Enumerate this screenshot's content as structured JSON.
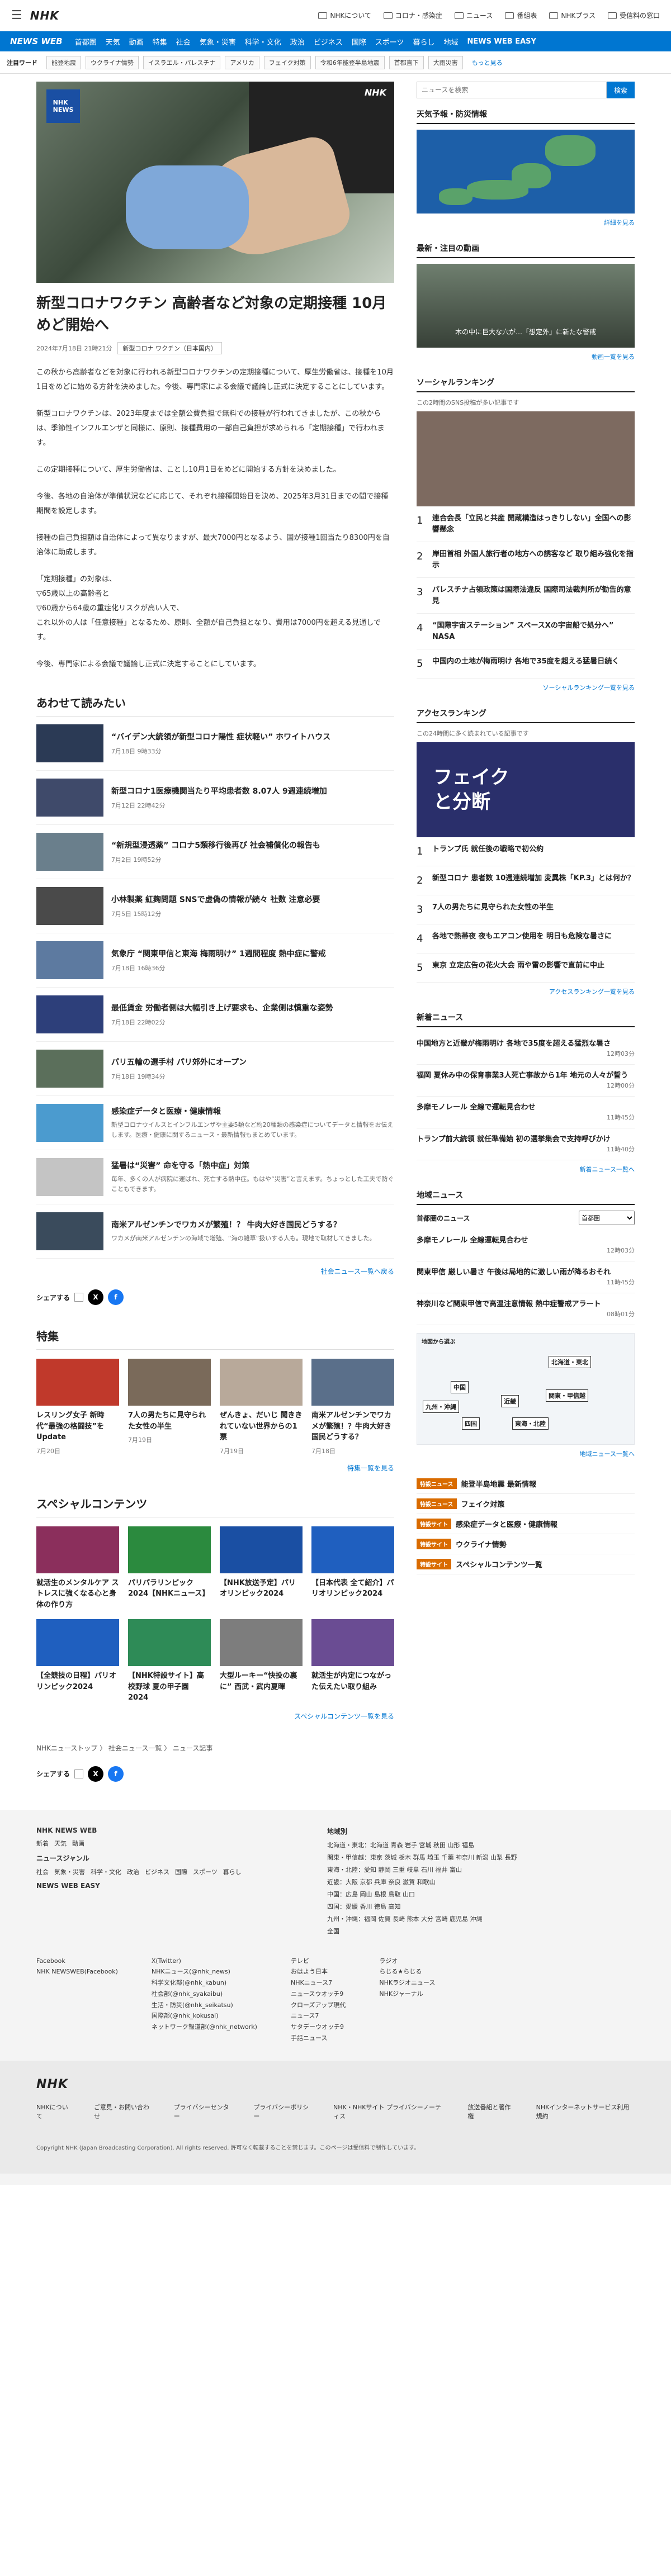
{
  "header": {
    "logo": "NHK",
    "links": [
      "NHKについて",
      "コロナ・感染症",
      "ニュース",
      "番組表",
      "NHKプラス",
      "受信料の窓口"
    ]
  },
  "nav": {
    "brand": "NEWS WEB",
    "items": [
      "首都圏",
      "天気",
      "動画",
      "特集",
      "社会",
      "気象・災害",
      "科学・文化",
      "政治",
      "ビジネス",
      "国際",
      "スポーツ",
      "暮らし",
      "地域",
      "NEWS WEB EASY"
    ]
  },
  "keywords": {
    "label": "注目ワード",
    "items": [
      "能登地震",
      "ウクライナ情勢",
      "イスラエル・パレスチナ",
      "アメリカ",
      "フェイク対策",
      "令和6年能登半島地震",
      "首都直下",
      "大雨災害"
    ],
    "more": "もっと見る"
  },
  "article": {
    "title": "新型コロナワクチン 高齢者など対象の定期接種 10月めど開始へ",
    "date": "2024年7月18日 21時21分",
    "tag": "新型コロナ ワクチン（日本国内）",
    "lead": "この秋から高齢者などを対象に行われる新型コロナワクチンの定期接種について、厚生労働省は、接種を10月1日をめどに始める方針を決めました。今後、専門家による会議で議論し正式に決定することにしています。",
    "paragraphs": [
      "新型コロナワクチンは、2023年度までは全額公費負担で無料での接種が行われてきましたが、この秋からは、季節性インフルエンザと同様に、原則、接種費用の一部自己負担が求められる「定期接種」で行われます。",
      "この定期接種について、厚生労働省は、ことし10月1日をめどに開始する方針を決めました。",
      "今後、各地の自治体が準備状況などに応じて、それぞれ接種開始日を決め、2025年3月31日までの間で接種期間を設定します。",
      "接種の自己負担額は自治体によって異なりますが、最大7000円となるよう、国が接種1回当たり8300円を自治体に助成します。",
      "「定期接種」の対象は、\n▽65歳以上の高齢者と\n▽60歳から64歳の重症化リスクが高い人で、\nこれ以外の人は「任意接種」となるため、原則、全額が自己負担となり、費用は7000円を超える見通しです。",
      "今後、専門家による会議で議論し正式に決定することにしています。"
    ]
  },
  "related": {
    "heading": "あわせて読みたい",
    "items": [
      {
        "title": "“バイデン大統領が新型コロナ陽性 症状軽い” ホワイトハウス",
        "date": "7月18日 9時33分",
        "desc": ""
      },
      {
        "title": "新型コロナ1医療機関当たり平均患者数 8.07人 9週連続増加",
        "date": "7月12日 22時42分",
        "desc": ""
      },
      {
        "title": "“新規型浸透薬” コロナ5類移行後再び 社会補償化の報告も",
        "date": "7月2日 19時52分",
        "desc": ""
      },
      {
        "title": "小林製薬 紅麹問題 SNSで虚偽の情報が続々 社数 注意必要",
        "date": "7月5日 15時12分",
        "desc": ""
      },
      {
        "title": "気象庁 “関東甲信と東海 梅雨明け” 1週間程度 熱中症に警戒",
        "date": "7月18日 16時36分",
        "desc": ""
      },
      {
        "title": "最低賃金 労働者側は大幅引き上げ要求も、企業側は慎重な姿勢",
        "date": "7月18日 22時02分",
        "desc": ""
      },
      {
        "title": "パリ五輪の選手村 パリ郊外にオープン",
        "date": "7月18日 19時34分",
        "desc": ""
      },
      {
        "title": "感染症データと医療・健康情報",
        "date": "",
        "desc": "新型コロナウイルスとインフルエンザや主要5類など約20種類の感染症についてデータと情報をお伝えします。医療・健康に関するニュース・最新情報もまとめています。"
      },
      {
        "title": "猛暑は“災害” 命を守る「熱中症」対策",
        "date": "",
        "desc": "毎年、多くの人が病院に運ばれ、死亡する熱中症。もはや“災害”と言えます。ちょっとした工夫で防ぐこともできます。"
      },
      {
        "title": "南米アルゼンチンでワカメが繁殖！？ 牛肉大好き国民どうする？",
        "date": "",
        "desc": "ワカメが南米アルゼンチンの海域で増殖、“海の雑草”扱いする人も。現地で取材してきました。"
      }
    ],
    "more": "社会ニュース一覧へ戻る"
  },
  "share": {
    "label": "シェアする"
  },
  "features": {
    "heading": "特集",
    "items": [
      {
        "title": "レスリング女子 新時代“最強の格闘技”をUpdate",
        "date": "7月20日"
      },
      {
        "title": "7人の男たちに見守られた女性の半生",
        "date": "7月19日"
      },
      {
        "title": "ぜんきょ、だいじ 聞ききれていない世界からの1票",
        "date": "7月19日"
      },
      {
        "title": "南米アルゼンチンでワカメが繁殖！？牛肉大好き国民どうする？",
        "date": "7月18日"
      }
    ],
    "more": "特集一覧を見る"
  },
  "special": {
    "heading": "スペシャルコンテンツ",
    "items": [
      {
        "title": "就活生のメンタルケア ストレスに強くなる心と身体の作り方"
      },
      {
        "title": "パリパラリンピック2024【NHKニュース】"
      },
      {
        "title": "【NHK放送予定】パリオリンピック2024"
      },
      {
        "title": "【日本代表 全て紹介】パリオリンピック2024"
      },
      {
        "title": "【全競技の日程】パリオリンピック2024"
      },
      {
        "title": "【NHK特設サイト】高校野球 夏の甲子園 2024"
      },
      {
        "title": "大型ルーキー“快投の裏に” 西武・武内夏暉"
      },
      {
        "title": "就活生が内定につながった伝えたい取り組み"
      }
    ],
    "more": "スペシャルコンテンツ一覧を見る"
  },
  "breadcrumb": [
    "NHKニューストップ",
    "社会ニュース一覧",
    "ニュース記事"
  ],
  "sidebar": {
    "search_placeholder": "ニュースを検索",
    "search_button": "検索",
    "weather": {
      "heading": "天気予報・防災情報",
      "more": "詳細を見る"
    },
    "video": {
      "heading": "最新・注目の動画",
      "caption": "木の中に巨大な穴が…「想定外」に新たな警戒",
      "more": "動画一覧を見る"
    },
    "social": {
      "heading": "ソーシャルランキング",
      "sub": "この2時間のSNS投稿が多い記事です",
      "items": [
        "連合会長「立民と共産 開蔵構造はっきりしない」全国への影響懸念",
        "岸田首相 外国人旅行者の地方への誘客など 取り組み強化を指示",
        "パレスチナ占領政策は国際法違反 国際司法裁判所が勧告的意見",
        "“国際宇宙ステーション” スペースXの宇宙船で処分へ” NASA",
        "中国内の土地が梅雨明け 各地で35度を超える猛暑日続く"
      ],
      "more": "ソーシャルランキング一覧を見る"
    },
    "access": {
      "heading": "アクセスランキング",
      "sub": "この24時間に多く読まれている記事です",
      "items": [
        "トランプ氏 就任後の戦略で初公約",
        "新型コロナ 患者数 10週連続増加 変異株「KP.3」とは何か？",
        "7人の男たちに見守られた女性の半生",
        "各地で熱帯夜 夜もエアコン使用を 明日も危険な暑さに",
        "東京 立定広告の花火大会 雨や雷の影響で直前に中止"
      ],
      "more": "アクセスランキング一覧を見る"
    },
    "latest": {
      "heading": "新着ニュース",
      "items": [
        {
          "title": "中国地方と近畿が梅雨明け 各地で35度を超える猛烈な暑さ",
          "time": "12時03分"
        },
        {
          "title": "福岡 夏休み中の保育事業3人死亡事故から1年 地元の人々が誓う",
          "time": "12時00分"
        },
        {
          "title": "多摩モノレール 全線で運転見合わせ",
          "time": "11時45分"
        },
        {
          "title": "トランプ前大統領 就任準備始 初の選挙集会で支持呼びかけ",
          "time": "11時40分"
        }
      ],
      "more": "新着ニュース一覧へ"
    },
    "regional": {
      "heading": "地域ニュース",
      "label": "首都圏のニュース",
      "select": "首都圏",
      "items": [
        {
          "title": "多摩モノレール 全線運転見合わせ",
          "time": "12時03分"
        },
        {
          "title": "関東甲信 厳しい暑さ 午後は局地的に激しい雨が降るおそれ",
          "time": "11時45分"
        },
        {
          "title": "神奈川など関東甲信で高温注意情報 熱中症警戒アラート",
          "time": "08時01分"
        }
      ],
      "map_label": "地図から選ぶ",
      "regions": [
        "北海道・東北",
        "関東・甲信越",
        "東海・北陸",
        "近畿",
        "中国",
        "四国",
        "九州・沖縄"
      ],
      "more": "地域ニュース一覧へ"
    },
    "links": [
      {
        "badge": "特設ニュース",
        "title": "能登半島地震 最新情報"
      },
      {
        "badge": "特設ニュース",
        "title": "フェイク対策"
      },
      {
        "badge": "特設サイト",
        "title": "感染症データと医療・健康情報"
      },
      {
        "badge": "特設サイト",
        "title": "ウクライナ情勢"
      },
      {
        "badge": "特設サイト",
        "title": "スペシャルコンテンツ一覧"
      }
    ]
  },
  "footer": {
    "site": "NHK NEWS WEB",
    "top": [
      "新着",
      "天気",
      "動画"
    ],
    "genre_label": "ニュースジャンル",
    "genres": [
      "社会",
      "気象・災害",
      "科学・文化",
      "政治",
      "ビジネス",
      "国際",
      "スポーツ",
      "暮らし"
    ],
    "easy": "NEWS WEB EASY",
    "region_heading": "地域別",
    "region_rows": [
      "北海道・東北：北海道 青森 岩手 宮城 秋田 山形 福島",
      "関東・甲信越：東京 茨城 栃木 群馬 埼玉 千葉 神奈川 新潟 山梨 長野",
      "東海・北陸：愛知 静岡 三重 岐阜 石川 福井 富山",
      "近畿：大阪 京都 兵庫 奈良 滋賀 和歌山",
      "中国：広島 岡山 島根 鳥取 山口",
      "四国：愛媛 香川 徳島 高知",
      "九州・沖縄：福岡 佐賀 長崎 熊本 大分 宮崎 鹿児島 沖縄",
      "全国"
    ],
    "sns_facebook": "Facebook\nNHK NEWSWEB(Facebook)",
    "sns_x": "X(Twitter)\nNHKニュース(@nhk_news)\n科学文化部(@nhk_kabun)\n社会部(@nhk_syakaibu)\n生活・防災(@nhk_seikatsu)\n国際部(@nhk_kokusai)\nネットワーク報道部(@nhk_network)",
    "sns_tv": "テレビ\nおはよう日本\nNHKニュース7\nニュースウオッチ9\nクローズアップ現代\nニュース7\nサタデーウオッチ9\n手話ニュース",
    "sns_radio": "ラジオ\nらじる★らじる\nNHKラジオニュース\nNHKジャーナル",
    "bottom_links": [
      "NHKについて",
      "ご意見・お問い合わせ",
      "プライバシーセンター",
      "プライバシーポリシー",
      "NHK・NHKサイト プライバシーノーティス",
      "放送番組と著作権",
      "NHKインターネットサービス利用規約"
    ],
    "copyright": "Copyright NHK (Japan Broadcasting Corporation). All rights reserved. 許可なく転載することを禁じます。このページは受信料で制作しています。"
  }
}
